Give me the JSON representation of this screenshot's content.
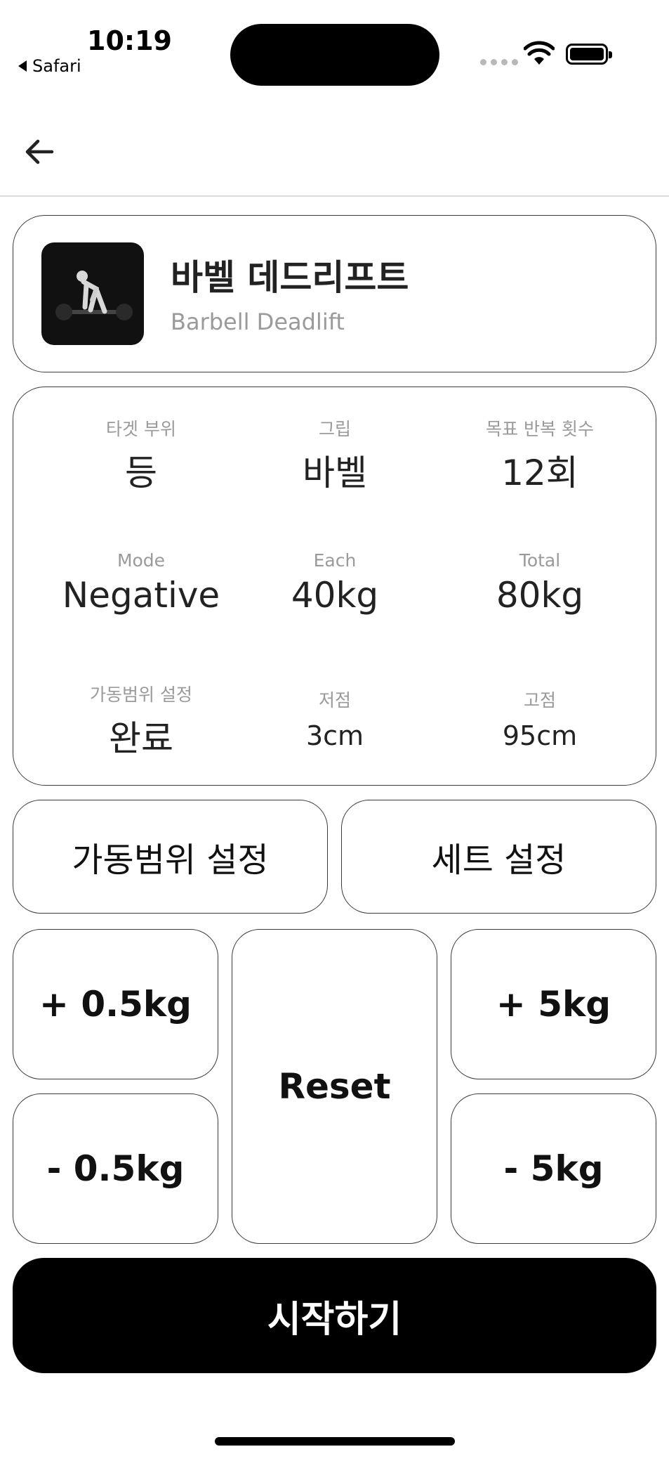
{
  "status_bar": {
    "time": "10:19",
    "back_app": "Safari"
  },
  "exercise": {
    "name_ko": "바벨 데드리프트",
    "name_en": "Barbell Deadlift"
  },
  "info": {
    "row1": [
      {
        "label": "타겟 부위",
        "value": "등"
      },
      {
        "label": "그립",
        "value": "바벨"
      },
      {
        "label": "목표 반복 횟수",
        "value": "12회"
      }
    ],
    "row2": [
      {
        "label": "Mode",
        "value": "Negative"
      },
      {
        "label": "Each",
        "value": "40kg"
      },
      {
        "label": "Total",
        "value": "80kg"
      }
    ],
    "row3": [
      {
        "label": "가동범위 설정",
        "value": "완료"
      },
      {
        "label": "저점",
        "value": "3cm"
      },
      {
        "label": "고점",
        "value": "95cm"
      }
    ]
  },
  "buttons": {
    "rom_setting": "가동범위 설정",
    "set_setting": "세트 설정",
    "plus_small": "+ 0.5kg",
    "minus_small": "- 0.5kg",
    "reset": "Reset",
    "plus_large": "+ 5kg",
    "minus_large": "- 5kg",
    "start": "시작하기"
  },
  "icons": {
    "back": "arrow-left-icon",
    "wifi": "wifi-icon",
    "battery": "battery-icon"
  }
}
